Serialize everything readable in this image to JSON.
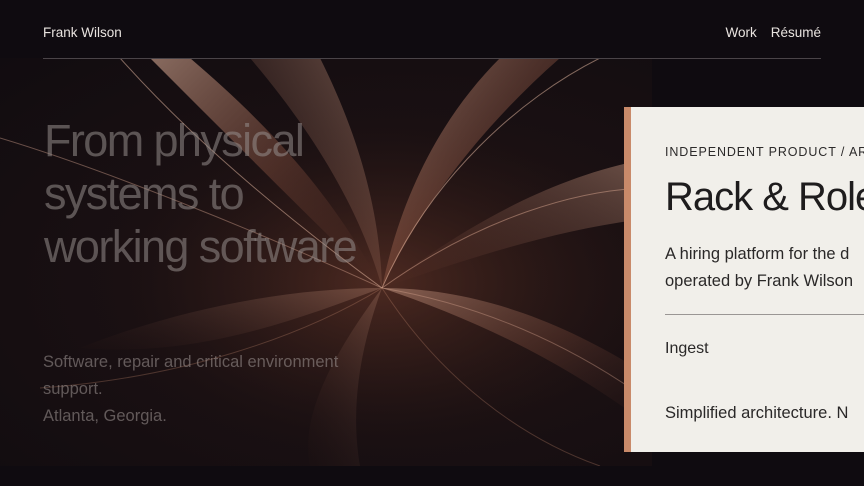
{
  "header": {
    "brand": "Frank Wilson",
    "nav": [
      {
        "label": "Work"
      },
      {
        "label": "Résumé"
      }
    ]
  },
  "hero": {
    "headline_lines": [
      "From physical",
      "systems to",
      "working software"
    ],
    "tagline_lines": [
      "Software, repair and critical environment",
      "support.",
      "Atlanta, Georgia."
    ]
  },
  "card": {
    "kicker": "INDEPENDENT PRODUCT / ARC",
    "title": "Rack & Role",
    "description_lines": [
      "A hiring platform for the d",
      "operated by Frank Wilson"
    ],
    "section_label": "Ingest",
    "note": "Simplified architecture. N"
  },
  "colors": {
    "background": "#0f0b10",
    "card_background": "#f1efea",
    "card_accent": "#c98a6a",
    "text_light": "#e9e4e0"
  },
  "icons": {
    "hero_art": "abstract-flowing-silk-art"
  }
}
